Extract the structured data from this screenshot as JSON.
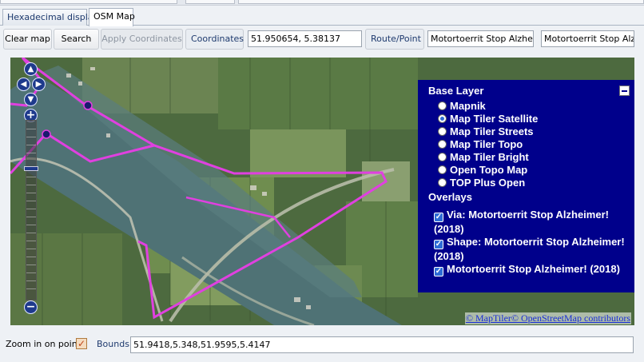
{
  "tabs": [
    {
      "label": "Hexadecimal display",
      "active": false
    },
    {
      "label": "OSM Map",
      "active": true
    }
  ],
  "toolbar": {
    "clear_map": "Clear map",
    "search": "Search",
    "apply_coordinates": "Apply Coordinates",
    "coordinates_label": "Coordinates",
    "coordinates_value": "51.950654, 5.38137",
    "route_point_label": "Route/Point",
    "route_point_value_1": "Motortoerrit Stop Alzheime",
    "route_point_value_2": "Motortoerrit Stop Alzhe"
  },
  "map": {
    "nav_icons": [
      "pan-up-icon",
      "pan-left-icon",
      "pan-right-icon",
      "pan-down-icon"
    ],
    "zoom_in": "+",
    "zoom_out": "−",
    "layer_switcher": {
      "base_layer_title": "Base Layer",
      "base_layers": [
        {
          "label": "Mapnik",
          "selected": false
        },
        {
          "label": "Map Tiler Satellite",
          "selected": true
        },
        {
          "label": "Map Tiler Streets",
          "selected": false
        },
        {
          "label": "Map Tiler Topo",
          "selected": false
        },
        {
          "label": "Map Tiler Bright",
          "selected": false
        },
        {
          "label": "Open Topo Map",
          "selected": false
        },
        {
          "label": "TOP Plus Open",
          "selected": false
        }
      ],
      "overlays_title": "Overlays",
      "overlays": [
        {
          "label": "Via: Motortoerrit Stop Alzheimer! (2018)",
          "checked": true
        },
        {
          "label": "Shape: Motortoerrit Stop Alzheimer! (2018)",
          "checked": true
        },
        {
          "label": "Motortoerrit Stop Alzheimer! (2018)",
          "checked": true
        }
      ]
    },
    "attribution": "© MapTiler© OpenStreetMap contributors",
    "route_color": "#e040e0",
    "panel_color": "#00008b"
  },
  "bottom": {
    "zoom_in_on_point": "Zoom in on point",
    "zoom_checked": true,
    "bounds_label": "Bounds",
    "bounds_value": "51.9418,5.348,51.9595,5.4147"
  }
}
